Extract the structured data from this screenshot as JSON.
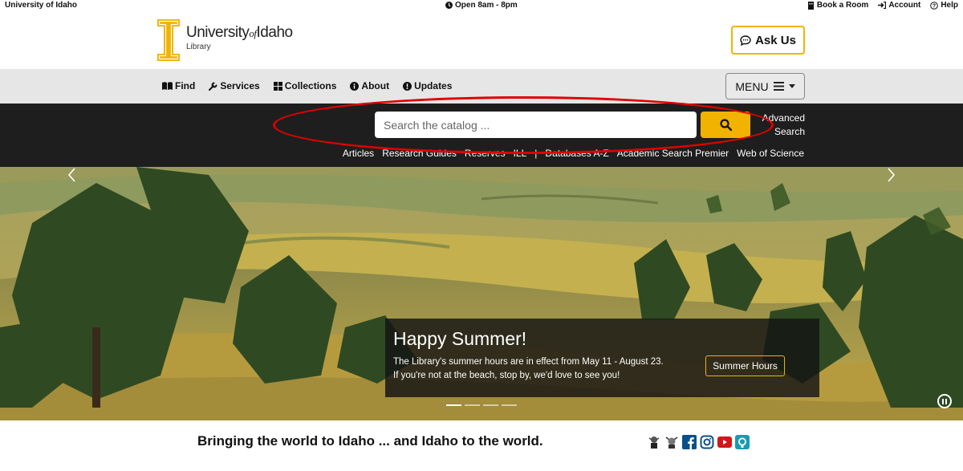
{
  "topbar": {
    "university": "University of Idaho",
    "hours": "Open 8am - 8pm",
    "links": [
      "Book a Room",
      "Account",
      "Help"
    ]
  },
  "header": {
    "logo_title_1": "University",
    "logo_title_of": "of",
    "logo_title_2": "Idaho",
    "logo_subtitle": "Library",
    "ask_us": "Ask Us"
  },
  "nav": {
    "items": [
      "Find",
      "Services",
      "Collections",
      "About",
      "Updates"
    ],
    "menu": "MENU"
  },
  "search": {
    "placeholder": "Search the catalog ...",
    "advanced_1": "Advanced",
    "advanced_2": "Search",
    "quicklinks": [
      "Articles",
      "Research Guides",
      "Reserves",
      "ILL",
      "|",
      "Databases A-Z",
      "Academic Search Premier",
      "Web of Science"
    ]
  },
  "hero": {
    "title": "Happy Summer!",
    "text": "The Library's summer hours are in effect from May 11 - August 23. If you're not at the beach, stop by, we'd love to see you!",
    "button": "Summer Hours",
    "slides": 4,
    "active_slide": 1
  },
  "footer": {
    "tagline": "Bringing the world to Idaho ... and Idaho to the world."
  },
  "colors": {
    "gold": "#f1b300",
    "dark": "#1e1e1e",
    "nav_bg": "#e6e6e6",
    "annotation": "#e00000"
  }
}
